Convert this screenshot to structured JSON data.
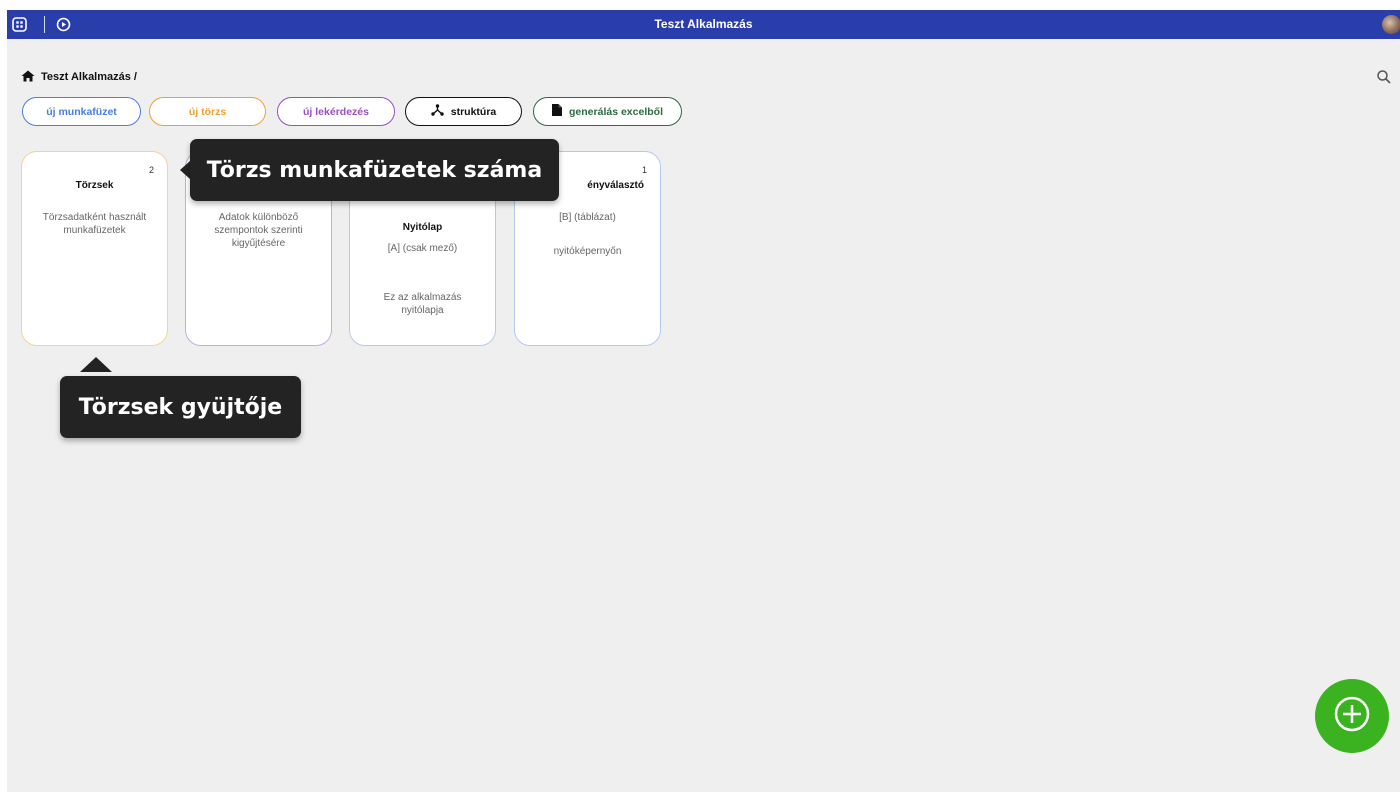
{
  "app": {
    "title": "Teszt Alkalmazás"
  },
  "breadcrumb": {
    "text": "Teszt Alkalmazás /"
  },
  "actions": [
    {
      "label": "új munkafüzet",
      "color": "#4a7ee0"
    },
    {
      "label": "új törzs",
      "color": "#f0a030"
    },
    {
      "label": "új lekérdezés",
      "color": "#9b4fc0"
    },
    {
      "label": "struktúra",
      "color": "#111111"
    },
    {
      "label": "generálás excelből",
      "color": "#2e6b3f"
    }
  ],
  "cards": [
    {
      "count": "2",
      "title": "Törzsek",
      "desc": "Törzsadatként használt munkafüzetek",
      "border": "#f3d58c"
    },
    {
      "desc": "Adatok különböző szempontok szerinti kigyűjtésére",
      "border": "#c8a9e6"
    },
    {
      "title": "Nyitólap",
      "sub": "[A] (csak mező)",
      "desc": "Ez az alkalmazás nyitólapja",
      "border": "#b5c9f0"
    },
    {
      "count": "1",
      "title": "ényválasztó",
      "sub": "[B] (táblázat)",
      "desc": "nyitóképernyőn",
      "border": "#b5c9f0"
    }
  ],
  "tooltips": {
    "count": "Törzs munkafüzetek száma",
    "collector": "Törzsek gyüjtője"
  },
  "colors": {
    "topbar": "#2a3eab",
    "fab": "#3bb21f",
    "background": "#efefef"
  }
}
